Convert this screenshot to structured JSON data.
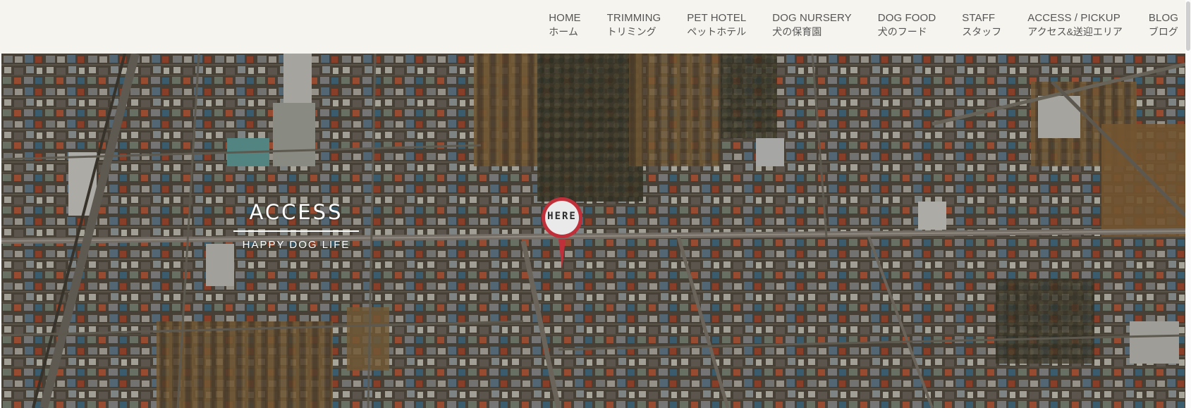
{
  "nav": {
    "items": [
      {
        "en": "HOME",
        "ja": "ホーム"
      },
      {
        "en": "TRIMMING",
        "ja": "トリミング"
      },
      {
        "en": "PET HOTEL",
        "ja": "ペットホテル"
      },
      {
        "en": "DOG NURSERY",
        "ja": "犬の保育園"
      },
      {
        "en": "DOG FOOD",
        "ja": "犬のフード"
      },
      {
        "en": "STAFF",
        "ja": "スタッフ"
      },
      {
        "en": "ACCESS / PICKUP",
        "ja": "アクセス&送迎エリア"
      },
      {
        "en": "BLOG",
        "ja": "ブログ"
      }
    ]
  },
  "hero": {
    "title": "ACCESS",
    "subtitle": "HAPPY DOG LIFE",
    "marker_label": "HERE"
  },
  "colors": {
    "header_bg": "#f6f4ee",
    "nav_text": "#555555",
    "marker_red": "#c0303a",
    "marker_fill": "#eaeaea"
  }
}
